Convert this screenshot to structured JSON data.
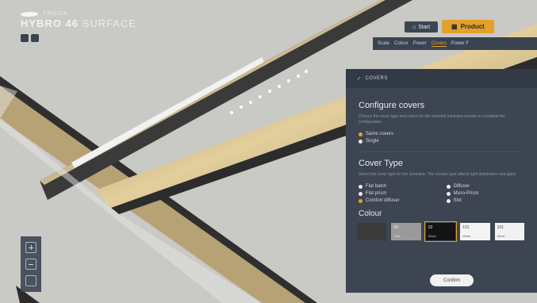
{
  "brand": {
    "logo_text": "TRILUX",
    "title_bold": "HYBRO 46",
    "title_thin": "SURFACE"
  },
  "header": {
    "start_label": "Start",
    "product_label": "Product"
  },
  "tabs": [
    {
      "label": "Scale"
    },
    {
      "label": "Colour"
    },
    {
      "label": "Power"
    },
    {
      "label": "Covers",
      "active": true
    },
    {
      "label": "Power F"
    }
  ],
  "panel": {
    "header_label": "COVERS",
    "configure": {
      "title": "Configure covers",
      "description": "Choose the cover type and colour for the selected luminaire section to complete the configuration.",
      "options": [
        {
          "label": "Same covers",
          "selected": true
        },
        {
          "label": "Single",
          "selected": false
        }
      ]
    },
    "cover_type": {
      "title": "Cover Type",
      "description": "Select the cover type for the luminaire. The chosen type affects light distribution and glare.",
      "options": [
        {
          "label": "Flat batch",
          "selected": false
        },
        {
          "label": "Diffuser",
          "selected": false
        },
        {
          "label": "Flat prism",
          "selected": false
        },
        {
          "label": "Micro-Prism",
          "selected": false
        },
        {
          "label": "Comfort diffuser",
          "selected": true
        },
        {
          "label": "Slot",
          "selected": false
        }
      ]
    },
    "colour": {
      "title": "Colour",
      "swatches": [
        {
          "name": "",
          "tone": "",
          "color": "#3a3a3a",
          "text_color": "#cfcfcf",
          "selected": false
        },
        {
          "name": "06",
          "tone": "Titan",
          "color": "#9a9a9a",
          "text_color": "#f0f0f0",
          "selected": false
        },
        {
          "name": "02",
          "tone": "Black",
          "color": "#141414",
          "text_color": "#e0e0e0",
          "selected": true
        },
        {
          "name": "101",
          "tone": "White",
          "color": "#f4f4f4",
          "text_color": "#444444",
          "selected": false
        },
        {
          "name": "101",
          "tone": "Silver",
          "color": "#f1f1f1",
          "text_color": "#444444",
          "selected": false
        }
      ]
    },
    "confirm_label": "Confirm"
  },
  "colors": {
    "accent": "#e3a12a",
    "panel": "#3c4551",
    "background": "#c9c9c5"
  }
}
